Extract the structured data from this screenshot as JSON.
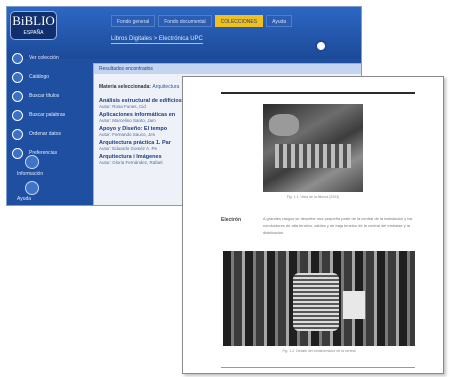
{
  "app": {
    "logo": "BiBLIO",
    "logo_sub": "ESPAÑA",
    "tabs": [
      {
        "label": "Fondo general",
        "active": false
      },
      {
        "label": "Fondo documental",
        "active": false
      },
      {
        "label": "COLECCIONES",
        "active": true
      },
      {
        "label": "Ayuda",
        "active": false
      }
    ],
    "breadcrumb": "Libros Digitales > Electrónica UPC",
    "sidebar": {
      "items": [
        {
          "label": "Ver colección"
        },
        {
          "label": "Catálogo"
        },
        {
          "label": "Buscar títulos"
        },
        {
          "label": "Buscar palabras"
        },
        {
          "label": "Ordenar datos"
        },
        {
          "label": "Preferencias"
        }
      ],
      "bottom_items": [
        {
          "label": "Información"
        },
        {
          "label": "Ayuda"
        }
      ]
    },
    "panel": {
      "header": "Resultados encontrados",
      "selection_label": "Materia seleccionada:",
      "selection_value": "Arquitectura",
      "results": [
        {
          "title": "Análisis estructural de edificios",
          "author": "Autor: Rosa Funes, Cid"
        },
        {
          "title": "Aplicaciones informáticas en",
          "author": "Autor: Marcelino Santo, Jam"
        },
        {
          "title": "Apoyo y Diseño: El tempo",
          "author": "Autor: Fernando Sauco, Jes"
        },
        {
          "title": "Arquitectura práctica 1. Par",
          "author": "Autor: Eduardo Goméz A. Pe"
        },
        {
          "title": "Arquitectura i Imágenes",
          "author": "Autor: Gloria Fernández, Rafael"
        }
      ]
    }
  },
  "document": {
    "caption1": "Fig. 1.1. Vista de la fábrica (2003)",
    "label": "Electrón",
    "paragraph": "A grandes rasgos se describe una pequeña parte de la central de la instalación y los conductores de alta tensión, cables y de baja tensión de la central del embalse y la distribución.",
    "caption2": "Fig. 1.2. Detalle del transformador de la central"
  }
}
